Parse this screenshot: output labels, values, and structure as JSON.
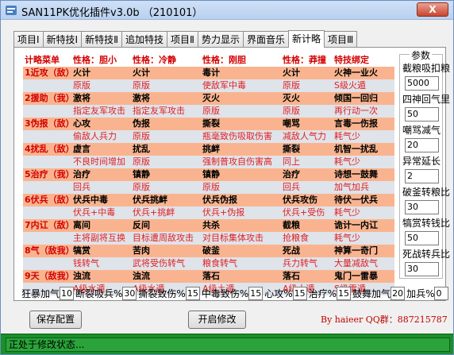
{
  "window": {
    "title": "SAN11PK优化插件v3.0b （210101）",
    "close_label": "X"
  },
  "tabs": [
    "项目Ⅰ",
    "新特技Ⅰ",
    "新特技Ⅱ",
    "追加特技",
    "项目Ⅱ",
    "势力显示",
    "界面音乐",
    "新计略",
    "项目Ⅲ"
  ],
  "active_tab": 7,
  "grid": {
    "headers": [
      "计略菜单",
      "性格：胆小",
      "性格：冷静",
      "性格：刚胆",
      "性格：莽撞",
      "特技绑定"
    ],
    "rows": [
      {
        "a": [
          "1近攻（敌）",
          "火计",
          "火计",
          "毒计",
          "火计",
          "火神一业火"
        ],
        "b": [
          "",
          "原版",
          "原版",
          "使敌军中毒",
          "原版",
          "S级火遁"
        ]
      },
      {
        "a": [
          "2援助（我）",
          "激将",
          "激将",
          "灭火",
          "灭火",
          "倾国一回归"
        ],
        "b": [
          "",
          "指定友军攻击",
          "指定友军攻击",
          "原版",
          "原版",
          "再行动一次"
        ]
      },
      {
        "a": [
          "3伪报（敌）",
          "心攻",
          "伪报",
          "撕裂",
          "嘲骂",
          "言毒一伤报"
        ],
        "b": [
          "",
          "偷敌人兵力",
          "原版",
          "瓶毫致伤吸取伤害",
          "减敌人气力",
          "耗气少"
        ]
      },
      {
        "a": [
          "4扰乱（敌）",
          "虚言",
          "扰乱",
          "挑衅",
          "撕裂",
          "机智一扰乱"
        ],
        "b": [
          "",
          "不良时间增加",
          "原版",
          "强制普攻自伤害高",
          "同上",
          "耗气少"
        ]
      },
      {
        "a": [
          "5治疗（我）",
          "治疗",
          "镇静",
          "镇静",
          "治疗",
          "诗想一鼓舞"
        ],
        "b": [
          "",
          "回兵",
          "原版",
          "原版",
          "回兵",
          "加气加兵"
        ]
      },
      {
        "a": [
          "6伏兵（敌）",
          "伏兵中毒",
          "伏兵挑衅",
          "伏兵伪报",
          "伏兵攻伤",
          "待伏一伏兵"
        ],
        "b": [
          "",
          "伏兵+中毒",
          "伏兵+挑衅",
          "伏兵+伪报",
          "伏兵+受伤",
          "耗气少"
        ]
      },
      {
        "a": [
          "7内讧（敌）",
          "离间",
          "反间",
          "共杀",
          "截粮",
          "诡计一内讧"
        ],
        "b": [
          "",
          "主将副将互换",
          "目标遭周敌攻击",
          "对目标集体攻击",
          "抢粮食",
          "耗气少"
        ]
      },
      {
        "a": [
          "8气（敌我）",
          "犒赏",
          "苦肉",
          "破釜",
          "死战",
          "神算一奇门"
        ],
        "b": [
          "",
          "钱转气",
          "武将受伤转气",
          "粮食转气",
          "兵力转气",
          "大量减敌气"
        ]
      },
      {
        "a": [
          "9天（敌我）",
          "浊流",
          "浊流",
          "落石",
          "落石",
          "鬼门一雷暴"
        ],
        "b": [
          "",
          "A级水遁",
          "A级水遁",
          "A级土遁",
          "A级土遁",
          "S级雷遁"
        ]
      }
    ]
  },
  "params": {
    "title": "参数",
    "items": [
      {
        "label": "截粮吸扣粮",
        "value": "5000"
      },
      {
        "label": "四神回气里",
        "value": "50"
      },
      {
        "label": "嘲骂减气",
        "value": "20"
      },
      {
        "label": "异常延长",
        "value": "2"
      },
      {
        "label": "破釜转粮比",
        "value": "30"
      },
      {
        "label": "犒赏转钱比",
        "value": "50"
      },
      {
        "label": "死战转兵比",
        "value": "30"
      }
    ]
  },
  "bottom_params": [
    {
      "label": "狂暴加气",
      "value": "10"
    },
    {
      "label": "断裂吸兵%",
      "value": "30"
    },
    {
      "label": "撕裂致伤%",
      "value": "15"
    },
    {
      "label": "中毒致伤%",
      "value": "15"
    },
    {
      "label": "心攻%",
      "value": "15"
    },
    {
      "label": "治疗%",
      "value": "15"
    },
    {
      "label": "鼓舞加气",
      "value": "20"
    },
    {
      "label": "加兵%",
      "value": "0"
    }
  ],
  "buttons": {
    "save": "保存配置",
    "start": "开启修改"
  },
  "credit": "By haieer   QQ群：887215787",
  "status": "正处于修改状态..."
}
